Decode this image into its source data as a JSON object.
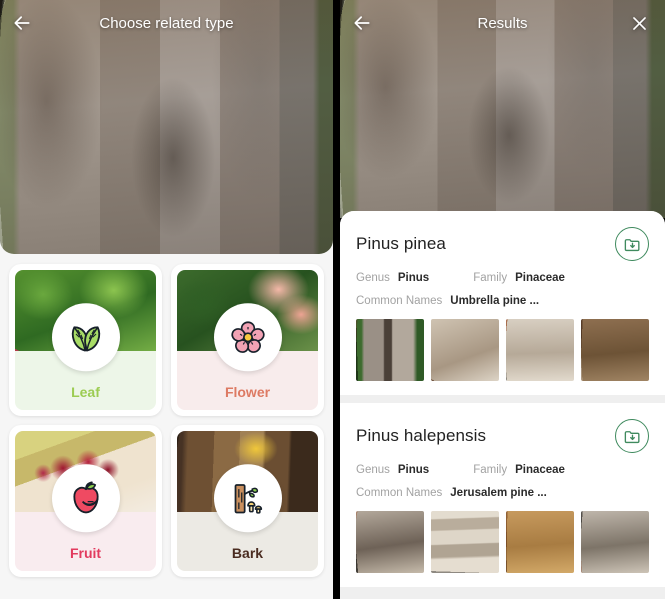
{
  "left_panel": {
    "header": {
      "title": "Choose related type",
      "back_icon": "back-arrow-icon"
    },
    "hero_photo_alt": "tree-bark-photo",
    "cards": [
      {
        "label": "Leaf",
        "icon": "leaf-icon",
        "label_color": "#9ccc52",
        "tint": "#edf6e8",
        "photo": "green-leaves-photo"
      },
      {
        "label": "Flower",
        "icon": "flower-icon",
        "label_color": "#dd7a63",
        "tint": "#f8ecec",
        "photo": "pink-roses-photo"
      },
      {
        "label": "Fruit",
        "icon": "apple-icon",
        "label_color": "#e23a5e",
        "tint": "#f9ecef",
        "photo": "cherries-photo"
      },
      {
        "label": "Bark",
        "icon": "bark-mushroom-icon",
        "label_color": "#4a2c20",
        "tint": "#eceae4",
        "photo": "tree-trunk-photo"
      }
    ]
  },
  "right_panel": {
    "header": {
      "title": "Results",
      "back_icon": "back-arrow-icon",
      "close_icon": "close-x-icon"
    },
    "hero_photo_alt": "tree-bark-photo",
    "labels": {
      "genus": "Genus",
      "family": "Family",
      "common_names": "Common Names"
    },
    "save_icon": "folder-download-icon",
    "save_icon_color": "#3f8a5e",
    "results": [
      {
        "name": "Pinus pinea",
        "genus": "Pinus",
        "family": "Pinaceae",
        "common_names": "Umbrella pine ...",
        "thumbnails": [
          "bark-thumb-1",
          "bark-thumb-2",
          "bark-thumb-3",
          "bark-thumb-4"
        ]
      },
      {
        "name": "Pinus halepensis",
        "genus": "Pinus",
        "family": "Pinaceae",
        "common_names": "Jerusalem pine ...",
        "thumbnails": [
          "bark-thumb-5",
          "bark-thumb-6",
          "bark-thumb-7",
          "bark-thumb-8"
        ]
      }
    ]
  }
}
